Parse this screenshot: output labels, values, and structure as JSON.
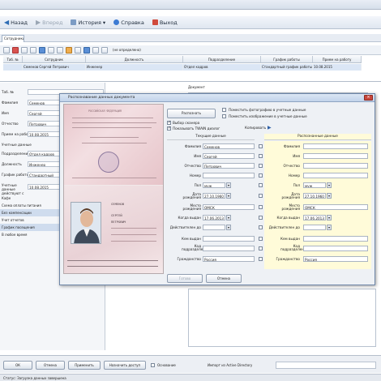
{
  "menu": {
    "back_label": "Назад",
    "forward_label": "Вперед",
    "history_label": "История",
    "help_label": "Справка",
    "exit_label": "Выход"
  },
  "tab": {
    "label": "Сотрудники"
  },
  "toolbar": {
    "filter_label": "(не определено)"
  },
  "grid": {
    "headers": [
      "Таб. №",
      "Сотрудник",
      "Должность",
      "Подразделение",
      "График работы",
      "Прием на работу"
    ],
    "row": [
      "",
      "Семенов Сергей Петрович",
      "Инженер",
      "Отдел кадров",
      "Стандартный график работы",
      "10.08.2015"
    ]
  },
  "left": {
    "fields": [
      {
        "label": "Таб. №",
        "value": ""
      },
      {
        "label": "Фамилия",
        "value": "Семенов"
      },
      {
        "label": "Имя",
        "value": "Сергей"
      },
      {
        "label": "Отчество",
        "value": "Петрович"
      },
      {
        "label": "Прием на работу",
        "value": "10.08.2015"
      },
      {
        "label": "Учетные данные",
        "value": ""
      },
      {
        "label": "Подразделение",
        "value": "Отдел кадров"
      },
      {
        "label": "Должность",
        "value": "Инженер"
      },
      {
        "label": "График работы",
        "value": "Стандартный"
      },
      {
        "label": "Учетные данные действуют с",
        "value": "10.08.2015"
      }
    ],
    "sublist": [
      "Кафе",
      "Схема оплаты питания",
      "Без компенсации",
      "Учет отчетов",
      "График посещения",
      "В любое время"
    ]
  },
  "right": {
    "document_label": "Документ"
  },
  "dialog": {
    "title": "Распознавание данных документа",
    "recognize_button": "Распознать",
    "opt_photo": "Поместить фотографию в учетные данные",
    "opt_image": "Поместить изображение в учетные данные",
    "opt_scanner": "Выбор сканера",
    "opt_twain": "Показывать TWAIN диалог",
    "copy_label": "Копировать",
    "current_header": "Текущие данные",
    "recognized_header": "Распознанные данные",
    "labels": {
      "lastname": "Фамилия",
      "firstname": "Имя",
      "patronymic": "Отчество",
      "number": "Номер",
      "sex": "Пол",
      "birthdate": "Дата рождения",
      "birthplace": "Место рождения",
      "issuedate": "Когда выдан",
      "validuntil": "Действителен до",
      "issuedby": "Кем выдан",
      "deptcode": "Код подразделения",
      "citizenship": "Гражданство"
    },
    "current": {
      "lastname": "Семенов",
      "firstname": "Сергей",
      "patronymic": "Петрович",
      "number": "",
      "sex": "муж",
      "birthdate": "27.10.1960",
      "birthplace": "ОМСК",
      "issuedate": "17.06.2013",
      "validuntil": "",
      "issuedby": "",
      "deptcode": "",
      "citizenship": "Россия"
    },
    "recognized": {
      "lastname": "",
      "firstname": "",
      "patronymic": "",
      "number": "",
      "sex": "муж",
      "birthdate": "27.10.1960",
      "birthplace": "ОМСК",
      "issuedate": "17.06.2013",
      "validuntil": "",
      "issuedby": "",
      "deptcode": "",
      "citizenship": "Россия"
    },
    "passport": {
      "country": "РОССИЙСКАЯ ФЕДЕРАЦИЯ",
      "surname": "СЕМЕНОВ",
      "name": "СЕРГЕЙ",
      "patronymic": "ПЕТРОВИЧ"
    },
    "ok_button": "Готово",
    "cancel_button": "Отмена"
  },
  "bottom": {
    "ok_label": "ОК",
    "cancel_label": "Отмена",
    "apply_label": "Применить",
    "access_label": "Назначить доступ",
    "basis_label": "Основание",
    "ad_label": "Импорт из Active Directory"
  },
  "status": {
    "text": "Статус: Загрузка данных завершена"
  }
}
